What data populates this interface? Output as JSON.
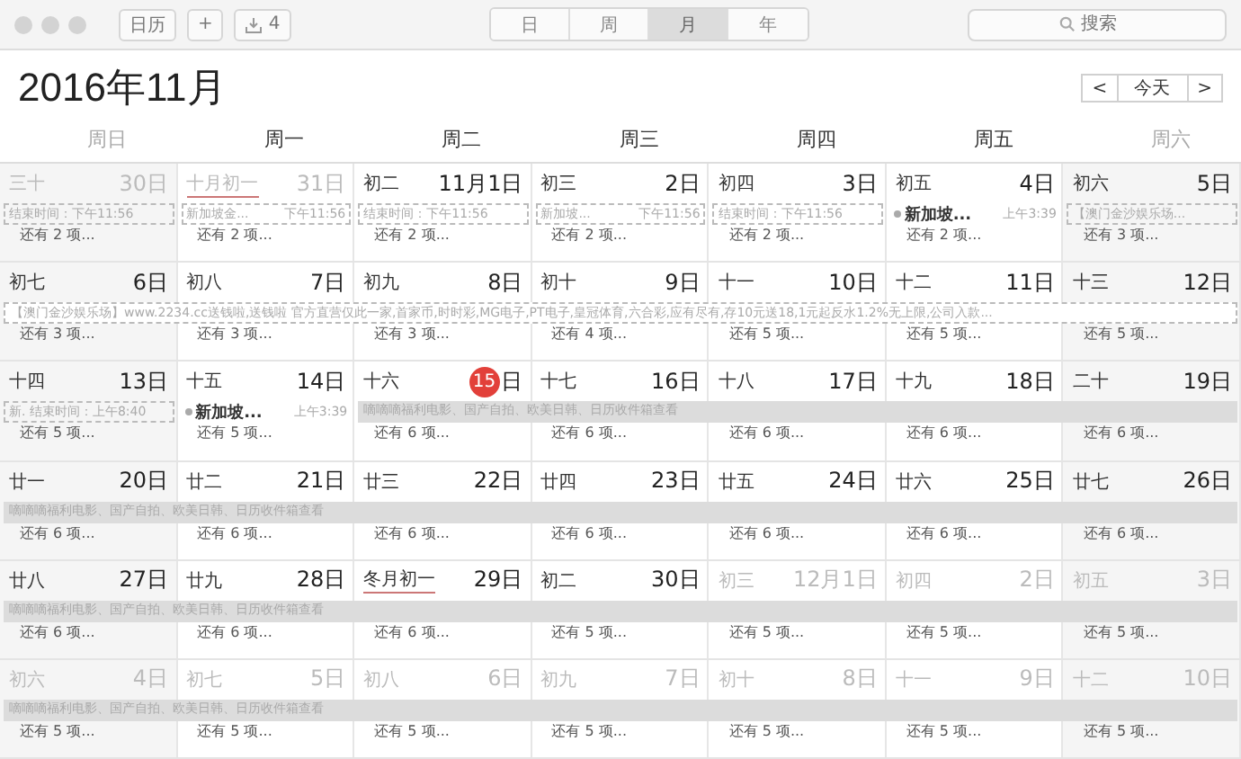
{
  "toolbar": {
    "calendars_button": "日历",
    "add_button": "+",
    "inbox_count": "4",
    "views": [
      {
        "label": "日",
        "selected": false
      },
      {
        "label": "周",
        "selected": false
      },
      {
        "label": "月",
        "selected": true
      },
      {
        "label": "年",
        "selected": false
      }
    ],
    "search": {
      "placeholder": "搜索"
    }
  },
  "title": "2016年11月",
  "nav": {
    "prev": "<",
    "today": "今天",
    "next": ">"
  },
  "weekdays": [
    "周日",
    "周一",
    "周二",
    "周三",
    "周四",
    "周五",
    "周六"
  ],
  "weeks": [
    {
      "cells": [
        {
          "lunar": "三十",
          "day": "30",
          "unit": "日",
          "in_month": false,
          "today": false,
          "lunar_month_start": false,
          "event": {
            "kind": "dashed",
            "title": "结束时间：下午11:56"
          },
          "more": "还有 2 项..."
        },
        {
          "lunar": "十月初一",
          "day": "31",
          "unit": "日",
          "in_month": false,
          "today": false,
          "lunar_month_start": true,
          "event": {
            "kind": "dashed",
            "title": "新加坡金...",
            "time": "下午11:56"
          },
          "more": "还有 2 项..."
        },
        {
          "lunar": "初二",
          "day": "11月1",
          "unit": "日",
          "in_month": true,
          "today": false,
          "lunar_month_start": false,
          "event": {
            "kind": "dashed",
            "title": "结束时间：下午11:56"
          },
          "more": "还有 2 项..."
        },
        {
          "lunar": "初三",
          "day": "2",
          "unit": "日",
          "in_month": true,
          "today": false,
          "lunar_month_start": false,
          "event": {
            "kind": "dashed",
            "title": "新加坡...",
            "time": "下午11:56"
          },
          "more": "还有 2 项..."
        },
        {
          "lunar": "初四",
          "day": "3",
          "unit": "日",
          "in_month": true,
          "today": false,
          "lunar_month_start": false,
          "event": {
            "kind": "dashed",
            "title": "结束时间：下午11:56"
          },
          "more": "还有 2 项..."
        },
        {
          "lunar": "初五",
          "day": "4",
          "unit": "日",
          "in_month": true,
          "today": false,
          "lunar_month_start": false,
          "event": {
            "kind": "dot",
            "title": "新加坡...",
            "time": "上午3:39"
          },
          "more": "还有 2 项..."
        },
        {
          "lunar": "初六",
          "day": "5",
          "unit": "日",
          "in_month": true,
          "today": false,
          "lunar_month_start": false,
          "event": {
            "kind": "dashed",
            "title": "【澳门金沙娱乐场..."
          },
          "more": "还有 3 项..."
        }
      ]
    },
    {
      "cells": [
        {
          "lunar": "初七",
          "day": "6",
          "unit": "日",
          "in_month": true,
          "today": false,
          "lunar_month_start": false,
          "all_day_event": {
            "kind": "dashed",
            "title": "【澳门金沙娱乐场】www.2234.cc送钱啦,送钱啦 官方直营仅此一家,首家币,时时彩,MG电子,PT电子,皇冠体育,六合彩,应有尽有,存10元送18,1元起反水1.2%无上限,公司入款..."
          },
          "more": "还有 3 项..."
        },
        {
          "lunar": "初八",
          "day": "7",
          "unit": "日",
          "in_month": true,
          "today": false,
          "lunar_month_start": false,
          "more": "还有 3 项..."
        },
        {
          "lunar": "初九",
          "day": "8",
          "unit": "日",
          "in_month": true,
          "today": false,
          "lunar_month_start": false,
          "more": "还有 3 项..."
        },
        {
          "lunar": "初十",
          "day": "9",
          "unit": "日",
          "in_month": true,
          "today": false,
          "lunar_month_start": false,
          "more": "还有 4 项..."
        },
        {
          "lunar": "十一",
          "day": "10",
          "unit": "日",
          "in_month": true,
          "today": false,
          "lunar_month_start": false,
          "more": "还有 5 项..."
        },
        {
          "lunar": "十二",
          "day": "11",
          "unit": "日",
          "in_month": true,
          "today": false,
          "lunar_month_start": false,
          "more": "还有 5 项..."
        },
        {
          "lunar": "十三",
          "day": "12",
          "unit": "日",
          "in_month": true,
          "today": false,
          "lunar_month_start": false,
          "more": "还有 5 项..."
        }
      ]
    },
    {
      "cells": [
        {
          "lunar": "十四",
          "day": "13",
          "unit": "日",
          "in_month": true,
          "today": false,
          "lunar_month_start": false,
          "event": {
            "kind": "dashed",
            "title": "新. 结束时间：上午8:40"
          },
          "more": "还有 5 项..."
        },
        {
          "lunar": "十五",
          "day": "14",
          "unit": "日",
          "in_month": true,
          "today": false,
          "lunar_month_start": false,
          "event": {
            "kind": "dot",
            "title": "新加坡...",
            "time": "上午3:39"
          },
          "more": "还有 5 项..."
        },
        {
          "lunar": "十六",
          "day": "15",
          "unit": "日",
          "in_month": true,
          "today": true,
          "lunar_month_start": false,
          "all_day_event": {
            "kind": "filled",
            "title": "嘀嘀嘀福利电影、国产自拍、欧美日韩、日历收件箱查看"
          },
          "more": "还有 6 项..."
        },
        {
          "lunar": "十七",
          "day": "16",
          "unit": "日",
          "in_month": true,
          "today": false,
          "lunar_month_start": false,
          "more": "还有 6 项..."
        },
        {
          "lunar": "十八",
          "day": "17",
          "unit": "日",
          "in_month": true,
          "today": false,
          "lunar_month_start": false,
          "more": "还有 6 项..."
        },
        {
          "lunar": "十九",
          "day": "18",
          "unit": "日",
          "in_month": true,
          "today": false,
          "lunar_month_start": false,
          "more": "还有 6 项..."
        },
        {
          "lunar": "二十",
          "day": "19",
          "unit": "日",
          "in_month": true,
          "today": false,
          "lunar_month_start": false,
          "more": "还有 6 项..."
        }
      ]
    },
    {
      "cells": [
        {
          "lunar": "廿一",
          "day": "20",
          "unit": "日",
          "in_month": true,
          "today": false,
          "lunar_month_start": false,
          "all_day_event": {
            "kind": "filled",
            "title": "嘀嘀嘀福利电影、国产自拍、欧美日韩、日历收件箱查看"
          },
          "more": "还有 6 项..."
        },
        {
          "lunar": "廿二",
          "day": "21",
          "unit": "日",
          "in_month": true,
          "today": false,
          "lunar_month_start": false,
          "more": "还有 6 项..."
        },
        {
          "lunar": "廿三",
          "day": "22",
          "unit": "日",
          "in_month": true,
          "today": false,
          "lunar_month_start": false,
          "more": "还有 6 项..."
        },
        {
          "lunar": "廿四",
          "day": "23",
          "unit": "日",
          "in_month": true,
          "today": false,
          "lunar_month_start": false,
          "more": "还有 6 项..."
        },
        {
          "lunar": "廿五",
          "day": "24",
          "unit": "日",
          "in_month": true,
          "today": false,
          "lunar_month_start": false,
          "more": "还有 6 项..."
        },
        {
          "lunar": "廿六",
          "day": "25",
          "unit": "日",
          "in_month": true,
          "today": false,
          "lunar_month_start": false,
          "more": "还有 6 项..."
        },
        {
          "lunar": "廿七",
          "day": "26",
          "unit": "日",
          "in_month": true,
          "today": false,
          "lunar_month_start": false,
          "more": "还有 6 项..."
        }
      ]
    },
    {
      "cells": [
        {
          "lunar": "廿八",
          "day": "27",
          "unit": "日",
          "in_month": true,
          "today": false,
          "lunar_month_start": false,
          "all_day_event": {
            "kind": "filled",
            "title": "嘀嘀嘀福利电影、国产自拍、欧美日韩、日历收件箱查看"
          },
          "more": "还有 6 项..."
        },
        {
          "lunar": "廿九",
          "day": "28",
          "unit": "日",
          "in_month": true,
          "today": false,
          "lunar_month_start": false,
          "more": "还有 6 项..."
        },
        {
          "lunar": "冬月初一",
          "day": "29",
          "unit": "日",
          "in_month": true,
          "today": false,
          "lunar_month_start": true,
          "more": "还有 6 项..."
        },
        {
          "lunar": "初二",
          "day": "30",
          "unit": "日",
          "in_month": true,
          "today": false,
          "lunar_month_start": false,
          "more": "还有 5 项..."
        },
        {
          "lunar": "初三",
          "day": "12月1",
          "unit": "日",
          "in_month": false,
          "today": false,
          "lunar_month_start": false,
          "more": "还有 5 项..."
        },
        {
          "lunar": "初四",
          "day": "2",
          "unit": "日",
          "in_month": false,
          "today": false,
          "lunar_month_start": false,
          "more": "还有 5 项..."
        },
        {
          "lunar": "初五",
          "day": "3",
          "unit": "日",
          "in_month": false,
          "today": false,
          "lunar_month_start": false,
          "more": "还有 5 项..."
        }
      ]
    },
    {
      "cells": [
        {
          "lunar": "初六",
          "day": "4",
          "unit": "日",
          "in_month": false,
          "today": false,
          "lunar_month_start": false,
          "all_day_event": {
            "kind": "filled",
            "title": "嘀嘀嘀福利电影、国产自拍、欧美日韩、日历收件箱查看"
          },
          "more": "还有 5 项..."
        },
        {
          "lunar": "初七",
          "day": "5",
          "unit": "日",
          "in_month": false,
          "today": false,
          "lunar_month_start": false,
          "more": "还有 5 项..."
        },
        {
          "lunar": "初八",
          "day": "6",
          "unit": "日",
          "in_month": false,
          "today": false,
          "lunar_month_start": false,
          "more": "还有 5 项..."
        },
        {
          "lunar": "初九",
          "day": "7",
          "unit": "日",
          "in_month": false,
          "today": false,
          "lunar_month_start": false,
          "more": "还有 5 项..."
        },
        {
          "lunar": "初十",
          "day": "8",
          "unit": "日",
          "in_month": false,
          "today": false,
          "lunar_month_start": false,
          "more": "还有 5 项..."
        },
        {
          "lunar": "十一",
          "day": "9",
          "unit": "日",
          "in_month": false,
          "today": false,
          "lunar_month_start": false,
          "more": "还有 5 项..."
        },
        {
          "lunar": "十二",
          "day": "10",
          "unit": "日",
          "in_month": false,
          "today": false,
          "lunar_month_start": false,
          "more": "还有 5 项..."
        }
      ]
    }
  ]
}
